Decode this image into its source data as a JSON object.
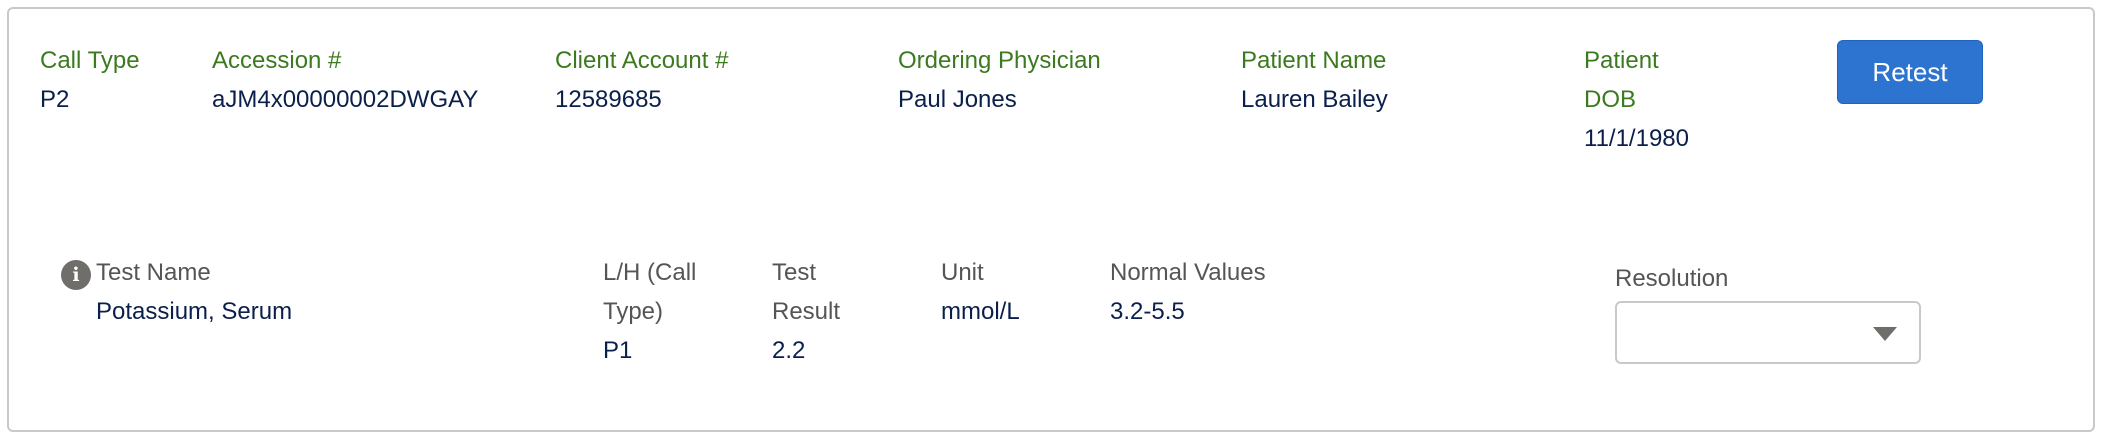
{
  "header_fields": {
    "call_type": {
      "label": "Call Type",
      "value": "P2"
    },
    "accession": {
      "label": "Accession #",
      "value": "aJM4x00000002DWGAY"
    },
    "client_account": {
      "label": "Client Account #",
      "value": "12589685"
    },
    "ordering_physician": {
      "label": "Ordering Physician",
      "value": "Paul Jones"
    },
    "patient_name": {
      "label": "Patient Name",
      "value": "Lauren Bailey"
    },
    "patient_dob": {
      "label_line1": "Patient",
      "label_line2": "DOB",
      "value": "11/1/1980"
    }
  },
  "actions": {
    "retest_label": "Retest"
  },
  "test_fields": {
    "info_icon": "i",
    "test_name": {
      "label": "Test Name",
      "value": "Potassium, Serum"
    },
    "lh_call_type": {
      "label_line1": "L/H (Call",
      "label_line2": "Type)",
      "value": "P1"
    },
    "test_result": {
      "label_line1": "Test",
      "label_line2": "Result",
      "value": "2.2"
    },
    "unit": {
      "label": "Unit",
      "value": "mmol/L"
    },
    "normal_values": {
      "label": "Normal Values",
      "value": "3.2-5.5"
    }
  },
  "resolution": {
    "label": "Resolution",
    "selected_value": ""
  },
  "colors": {
    "label_green": "#3b7a1f",
    "value_navy": "#0b1f4b",
    "button_blue": "#2d74d1"
  }
}
